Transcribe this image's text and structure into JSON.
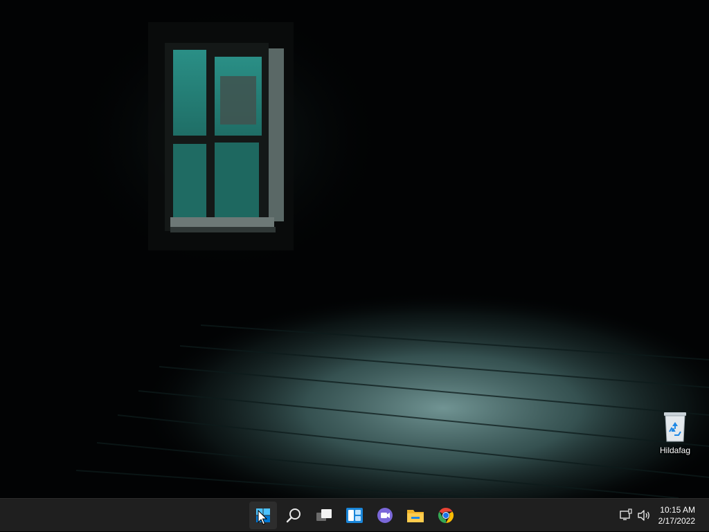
{
  "desktop": {
    "icons": [
      {
        "label": "Hildafag",
        "icon": "recycle-bin-icon"
      }
    ]
  },
  "taskbar": {
    "pinned": [
      {
        "name": "start",
        "icon": "windows-logo-icon",
        "active": true
      },
      {
        "name": "search",
        "icon": "search-icon"
      },
      {
        "name": "task-view",
        "icon": "task-view-icon"
      },
      {
        "name": "widgets",
        "icon": "widgets-icon"
      },
      {
        "name": "chat",
        "icon": "teams-chat-icon"
      },
      {
        "name": "file-explorer",
        "icon": "folder-icon"
      },
      {
        "name": "chrome",
        "icon": "chrome-icon"
      }
    ],
    "tray": {
      "network_icon": "network-icon",
      "volume_icon": "volume-icon",
      "time": "10:15 AM",
      "date": "2/17/2022"
    }
  },
  "colors": {
    "taskbar_bg": "#1f1f1f",
    "accent": "#0078d4"
  }
}
